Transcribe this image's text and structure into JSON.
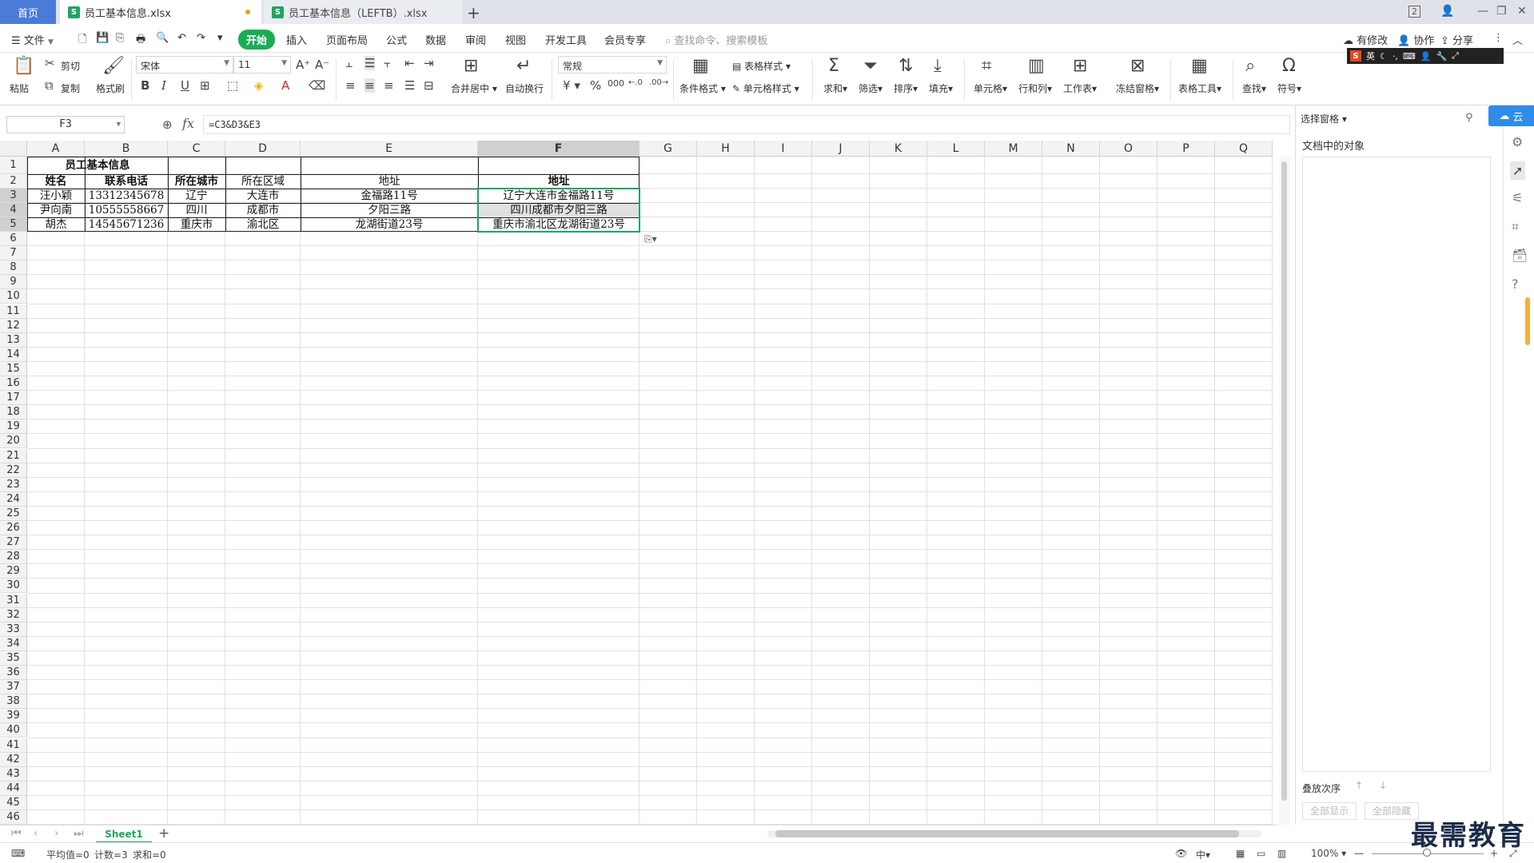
{
  "tabs": {
    "home": "首页",
    "file1": "员工基本信息.xlsx",
    "file2": "员工基本信息（LEFTB）.xlsx",
    "add": "+"
  },
  "window": {
    "page_count": "2"
  },
  "menu": {
    "file": "文件",
    "items": [
      "开始",
      "插入",
      "页面布局",
      "公式",
      "数据",
      "审阅",
      "视图",
      "开发工具",
      "会员专享"
    ],
    "search": "查找命令、搜索模板",
    "modified": "有修改",
    "collab": "协作",
    "share": "分享"
  },
  "ribbon": {
    "paste": "粘贴",
    "cut": "剪切",
    "copy": "复制",
    "format_painter": "格式刷",
    "font_name": "宋体",
    "font_size": "11",
    "bold": "B",
    "italic": "I",
    "underline": "U",
    "merge_center": "合并居中",
    "wrap": "自动换行",
    "number_format": "常规",
    "currency": "¥",
    "percent": "%",
    "thousands": "000",
    "table_style": "表格样式",
    "cond_format": "条件格式",
    "cell_style": "单元格样式",
    "sum": "求和",
    "filter": "筛选",
    "sort": "排序",
    "fill": "填充",
    "cell": "单元格",
    "row_col": "行和列",
    "worksheet": "工作表",
    "freeze": "冻结窗格",
    "table_tools": "表格工具",
    "find": "查找",
    "symbol": "符号"
  },
  "ime": {
    "s": "S",
    "lang": "英"
  },
  "formula_bar": {
    "name_box": "F3",
    "fx": "fx",
    "formula": "=C3&D3&E3"
  },
  "sheet": {
    "columns": [
      "A",
      "B",
      "C",
      "D",
      "E",
      "F",
      "G",
      "H",
      "I",
      "J",
      "K",
      "L",
      "M",
      "N",
      "O",
      "P",
      "Q"
    ],
    "title": "员工基本信息",
    "headers": [
      "姓名",
      "联系电话",
      "所在城市",
      "所在区域",
      "地址",
      "地址"
    ],
    "rows": [
      [
        "汪小颖",
        "13312345678",
        "辽宁",
        "大连市",
        "金福路11号",
        "辽宁大连市金福路11号"
      ],
      [
        "尹向南",
        "10555558667",
        "四川",
        "成都市",
        "夕阳三路",
        "四川成都市夕阳三路"
      ],
      [
        "胡杰",
        "14545671236",
        "重庆市",
        "渝北区",
        "龙湖街道23号",
        "重庆市渝北区龙湖街道23号"
      ]
    ],
    "row_count": 46
  },
  "taskpane": {
    "title": "选择窗格",
    "subtitle": "文档中的对象",
    "order": "叠放次序",
    "show_all": "全部显示",
    "hide_all": "全部隐藏",
    "cloud": "云"
  },
  "sheet_tabs": {
    "active": "Sheet1",
    "add": "+"
  },
  "status": {
    "average": "平均值=0",
    "count": "计数=3",
    "sum": "求和=0",
    "zoom": "100%"
  },
  "watermark": "最需教育"
}
